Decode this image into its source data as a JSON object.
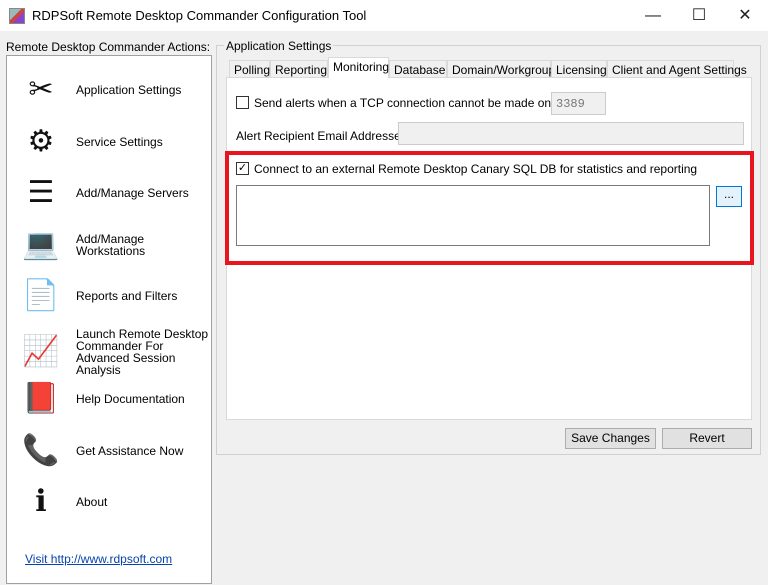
{
  "window": {
    "title": "RDPSoft Remote Desktop Commander Configuration Tool",
    "minimize": "—",
    "maximize": "☐",
    "close": "✕"
  },
  "sidebar": {
    "label": "Remote Desktop Commander Actions:",
    "items": [
      {
        "label": "Application Settings",
        "icon": "tools-icon",
        "glyph": "✂"
      },
      {
        "label": "Service Settings",
        "icon": "gear-icon",
        "glyph": "⚙"
      },
      {
        "label": "Add/Manage Servers",
        "icon": "servers-icon",
        "glyph": "☰"
      },
      {
        "label": "Add/Manage Workstations",
        "icon": "laptop-icon",
        "glyph": "💻"
      },
      {
        "label": "Reports and Filters",
        "icon": "report-icon",
        "glyph": "📄"
      },
      {
        "label": "Launch Remote Desktop Commander For Advanced Session Analysis",
        "icon": "chart-line-icon",
        "glyph": "📈"
      },
      {
        "label": "Help Documentation",
        "icon": "book-icon",
        "glyph": "📕"
      },
      {
        "label": "Get Assistance Now",
        "icon": "phone-icon",
        "glyph": "📞"
      },
      {
        "label": "About",
        "icon": "info-icon",
        "glyph": "ℹ"
      }
    ],
    "link": "Visit http://www.rdpsoft.com"
  },
  "main": {
    "group_label": "Application Settings",
    "tabs": [
      "Polling",
      "Reporting",
      "Monitoring",
      "Database",
      "Domain/Workgroup",
      "Licensing",
      "Client and Agent Settings"
    ],
    "active_tab": "Monitoring",
    "tcp_alert": {
      "label": "Send alerts when a TCP connection cannot be made on port",
      "checked": false,
      "port": "3389"
    },
    "email": {
      "label": "Alert Recipient Email Addresses:",
      "value": ""
    },
    "canary": {
      "label": "Connect to an external Remote Desktop Canary SQL DB for statistics and reporting",
      "checked": true,
      "connection": "",
      "browse": "..."
    },
    "save": "Save Changes",
    "revert": "Revert"
  },
  "colors": {
    "highlight": "#e8141e"
  }
}
